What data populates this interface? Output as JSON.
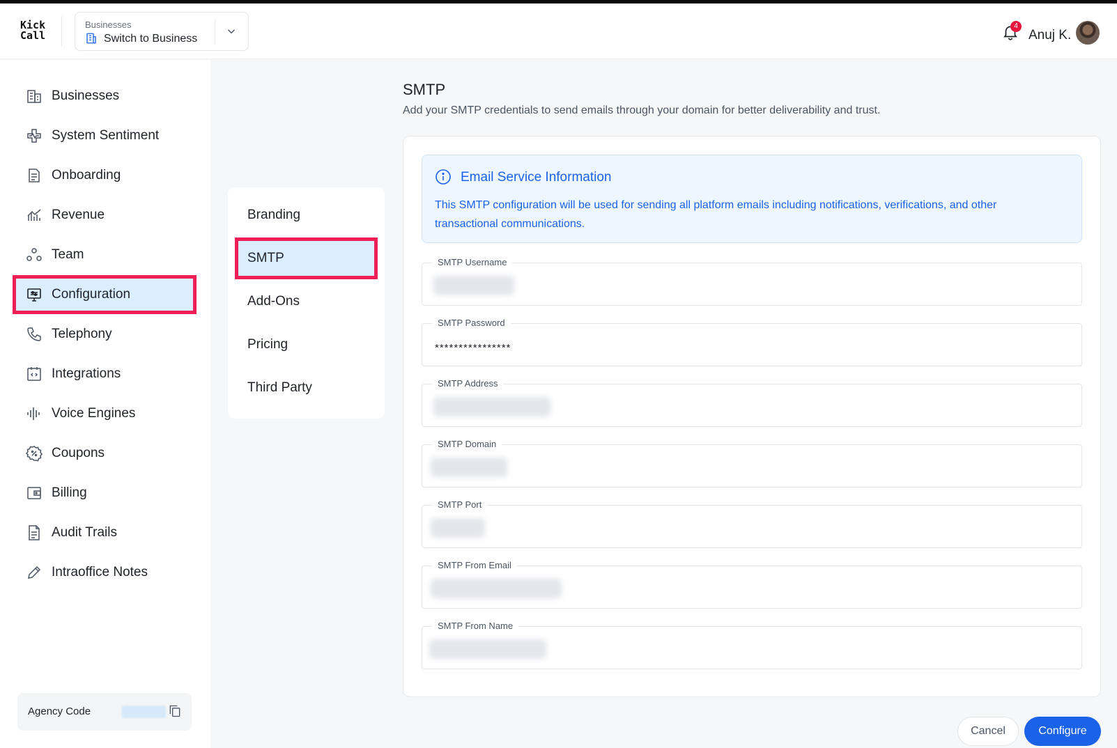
{
  "app": {
    "logo_line1": "Kick",
    "logo_line2": "Call",
    "business_switcher": {
      "label": "Businesses",
      "value": "Switch to Business"
    },
    "notifications_count": "4",
    "user_name": "Anuj K."
  },
  "sidebar": {
    "items": [
      {
        "label": "Businesses",
        "icon": "building-icon"
      },
      {
        "label": "System Sentiment",
        "icon": "pulse-icon"
      },
      {
        "label": "Onboarding",
        "icon": "document-icon"
      },
      {
        "label": "Revenue",
        "icon": "revenue-chart-icon"
      },
      {
        "label": "Team",
        "icon": "team-icon"
      },
      {
        "label": "Configuration",
        "icon": "monitor-settings-icon",
        "active": true
      },
      {
        "label": "Telephony",
        "icon": "phone-icon"
      },
      {
        "label": "Integrations",
        "icon": "code-box-icon"
      },
      {
        "label": "Voice Engines",
        "icon": "waveform-icon"
      },
      {
        "label": "Coupons",
        "icon": "coupon-icon"
      },
      {
        "label": "Billing",
        "icon": "wallet-icon"
      },
      {
        "label": "Audit Trails",
        "icon": "file-lines-icon"
      },
      {
        "label": "Intraoffice Notes",
        "icon": "pencil-icon"
      }
    ],
    "agency_code_label": "Agency Code"
  },
  "subnav": {
    "items": [
      {
        "label": "Branding"
      },
      {
        "label": "SMTP",
        "active": true
      },
      {
        "label": "Add-Ons"
      },
      {
        "label": "Pricing"
      },
      {
        "label": "Third Party"
      }
    ]
  },
  "main": {
    "title": "SMTP",
    "description": "Add your SMTP credentials to send emails through your domain for better deliverability and trust.",
    "info": {
      "title": "Email Service Information",
      "text": "This SMTP configuration will be used for sending all platform emails including notifications, verifications, and other transactional communications."
    },
    "fields": [
      {
        "label": "SMTP Username",
        "value": ""
      },
      {
        "label": "SMTP Password",
        "value": "****************"
      },
      {
        "label": "SMTP Address",
        "value": ""
      },
      {
        "label": "SMTP Domain",
        "value": ""
      },
      {
        "label": "SMTP Port",
        "value": ""
      },
      {
        "label": "SMTP From Email",
        "value": ""
      },
      {
        "label": "SMTP From Name",
        "value": ""
      }
    ],
    "cancel_label": "Cancel",
    "configure_label": "Configure"
  },
  "colors": {
    "accent": "#1a63e8",
    "active_bg": "#dbeeff",
    "highlight_outline": "#ef1f57",
    "badge": "#e5173f"
  }
}
